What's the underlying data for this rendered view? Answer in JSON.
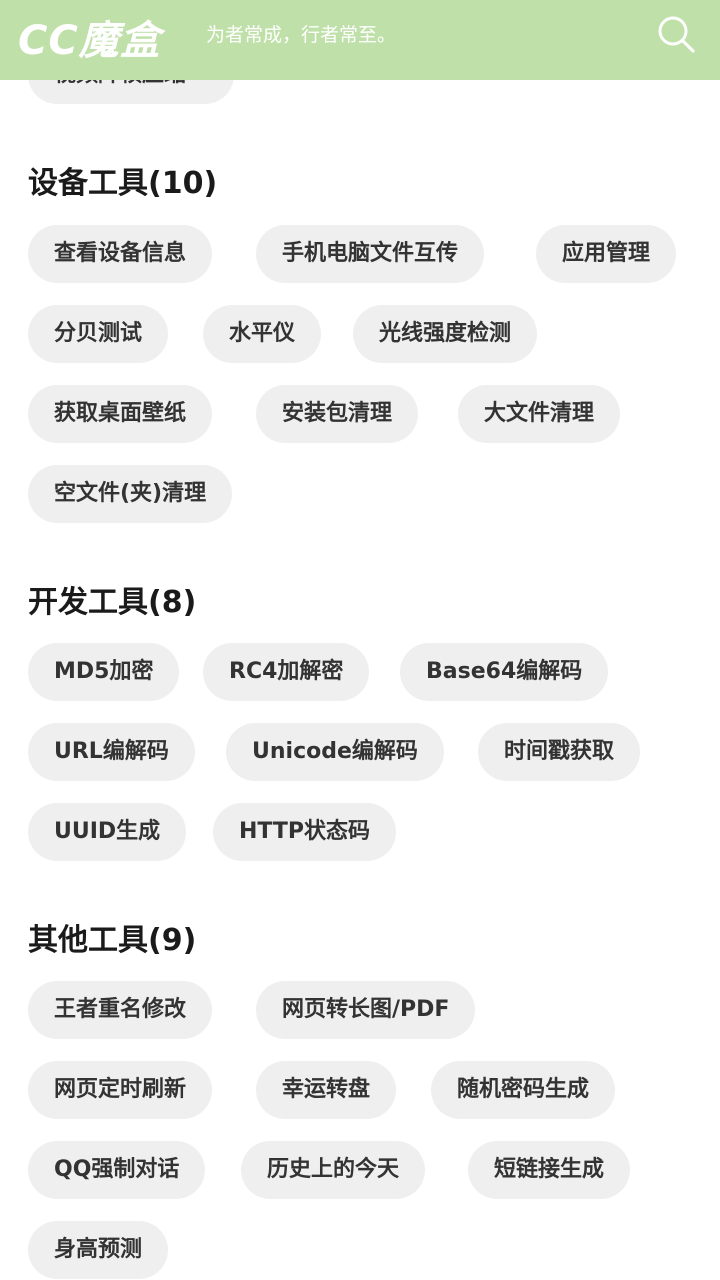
{
  "header": {
    "logo": "CC魔盒",
    "slogan": "为者常成，行者常至。",
    "search_icon": "search-icon"
  },
  "top_partial_chip": "视频降帧压缩",
  "sections": [
    {
      "title": "设备工具(10)",
      "items": [
        "查看设备信息",
        "手机电脑文件互传",
        "应用管理",
        "分贝测试",
        "水平仪",
        "光线强度检测",
        "获取桌面壁纸",
        "安装包清理",
        "大文件清理",
        "空文件(夹)清理"
      ]
    },
    {
      "title": "开发工具(8)",
      "items": [
        "MD5加密",
        "RC4加解密",
        "Base64编解码",
        "URL编解码",
        "Unicode编解码",
        "时间戳获取",
        "UUID生成",
        "HTTP状态码"
      ]
    },
    {
      "title": "其他工具(9)",
      "items": [
        "王者重名修改",
        "网页转长图/PDF",
        "网页定时刷新",
        "幸运转盘",
        "随机密码生成",
        "QQ强制对话",
        "历史上的今天",
        "短链接生成",
        "身高预测"
      ]
    }
  ]
}
